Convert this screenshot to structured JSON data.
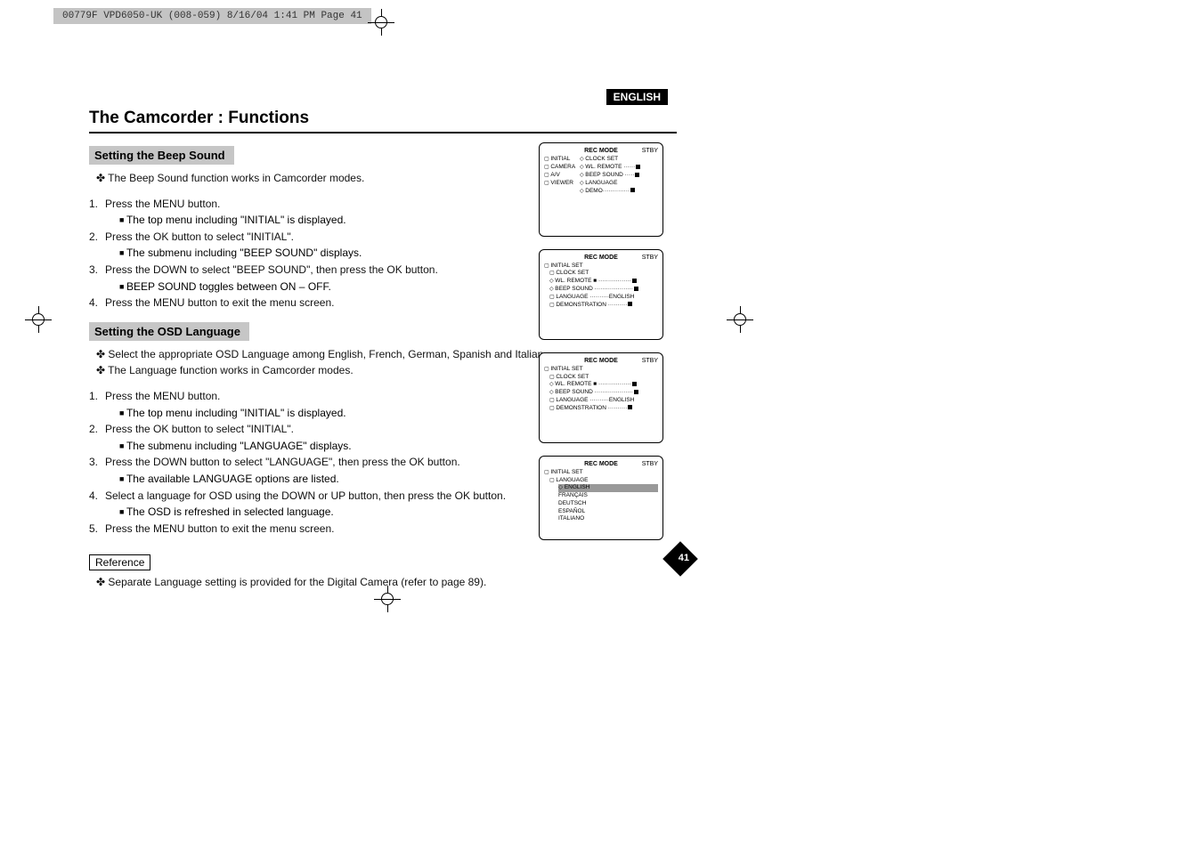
{
  "header": "00779F VPD6050-UK (008-059)  8/16/04 1:41 PM  Page 41",
  "lang_badge": "ENGLISH",
  "page_number": "41",
  "main_title": "The Camcorder : Functions",
  "section1": {
    "title": "Setting the Beep Sound",
    "bullets": [
      "The Beep Sound function works in Camcorder modes."
    ],
    "steps": [
      {
        "num": "1.",
        "text": "Press the MENU button.",
        "sub": "The top menu including \"INITIAL\" is displayed."
      },
      {
        "num": "2.",
        "text": "Press the OK button to select \"INITIAL\".",
        "sub": "The submenu including \"BEEP SOUND\" displays."
      },
      {
        "num": "3.",
        "text": "Press the DOWN to select \"BEEP SOUND\", then press the OK button.",
        "sub": "BEEP SOUND toggles between ON – OFF."
      },
      {
        "num": "4.",
        "text": "Press the MENU button to exit the menu screen.",
        "sub": null
      }
    ]
  },
  "section2": {
    "title": "Setting the OSD Language",
    "bullets": [
      "Select the appropriate OSD Language among English, French, German, Spanish and Italian.",
      "The Language function works in Camcorder modes."
    ],
    "steps": [
      {
        "num": "1.",
        "text": "Press the MENU button.",
        "sub": "The top menu including \"INITIAL\" is displayed."
      },
      {
        "num": "2.",
        "text": "Press the OK button to select \"INITIAL\".",
        "sub": "The submenu including \"LANGUAGE\" displays."
      },
      {
        "num": "3.",
        "text": "Press the DOWN button to select \"LANGUAGE\", then press the OK button.",
        "sub": "The available LANGUAGE options are listed."
      },
      {
        "num": "4.",
        "text": "Select a language for OSD using the DOWN or UP button, then press the OK button.",
        "sub": "The OSD is refreshed in selected language."
      },
      {
        "num": "5.",
        "text": "Press the MENU button to exit the menu screen.",
        "sub": null
      }
    ]
  },
  "reference": {
    "label": "Reference",
    "text": "Separate Language setting is provided for the Digital Camera (refer to page 89)."
  },
  "screens": {
    "mode_label": "REC MODE",
    "stby": "STBY",
    "s1": {
      "left": [
        "INITIAL",
        "CAMERA",
        "A/V",
        "VIEWER"
      ],
      "right": [
        "CLOCK SET",
        "WL. REMOTE",
        "BEEP SOUND",
        "LANGUAGE",
        "DEMO"
      ]
    },
    "s2": {
      "heading": "INITIAL SET",
      "items": [
        "CLOCK SET",
        "WL. REMOTE",
        "BEEP SOUND",
        "LANGUAGE",
        "DEMONSTRATION"
      ],
      "lang_val": "ENGLISH"
    },
    "s3": {
      "heading": "INITIAL SET",
      "items": [
        "CLOCK SET",
        "WL. REMOTE",
        "BEEP SOUND",
        "LANGUAGE",
        "DEMONSTRATION"
      ],
      "lang_val": "ENGLISH"
    },
    "s4": {
      "heading": "INITIAL SET",
      "sub": "LANGUAGE",
      "langs": [
        "ENGLISH",
        "FRANÇAIS",
        "DEUTSCH",
        "ESPAÑOL",
        "ITALIANO"
      ]
    }
  }
}
